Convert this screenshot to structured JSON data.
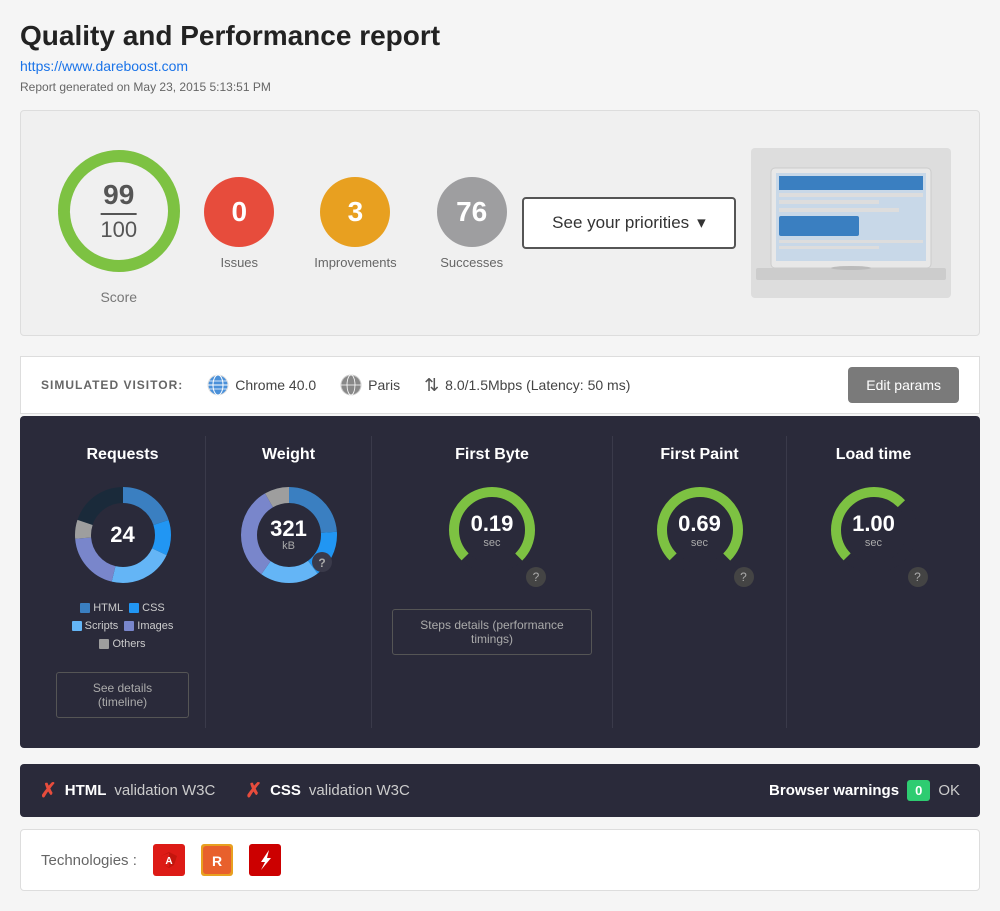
{
  "header": {
    "title": "Quality and Performance report",
    "url": "https://www.dareboost.com",
    "date": "Report generated on May 23, 2015 5:13:51 PM"
  },
  "score_panel": {
    "score_num": "99",
    "score_denom": "100",
    "score_label": "Score",
    "issues": {
      "value": "0",
      "label": "Issues"
    },
    "improvements": {
      "value": "3",
      "label": "Improvements"
    },
    "successes": {
      "value": "76",
      "label": "Successes"
    },
    "priorities_btn": "See your priorities"
  },
  "visitor_bar": {
    "label": "SIMULATED VISITOR:",
    "browser": "Chrome 40.0",
    "location": "Paris",
    "speed": "8.0/1.5Mbps (Latency: 50 ms)",
    "edit_btn": "Edit params"
  },
  "metrics": {
    "requests": {
      "title": "Requests",
      "value": "24",
      "legend": [
        {
          "color": "#3a7fc1",
          "label": "HTML"
        },
        {
          "color": "#2196F3",
          "label": "CSS"
        },
        {
          "color": "#64b5f6",
          "label": "Scripts"
        },
        {
          "color": "#7986cb",
          "label": "Images"
        },
        {
          "color": "#9e9e9e",
          "label": "Others"
        }
      ]
    },
    "weight": {
      "title": "Weight",
      "value": "321",
      "unit": "kB"
    },
    "first_byte": {
      "title": "First Byte",
      "value": "0.19",
      "unit": "sec"
    },
    "first_paint": {
      "title": "First Paint",
      "value": "0.69",
      "unit": "sec"
    },
    "load_time": {
      "title": "Load time",
      "value": "1.00",
      "unit": "sec"
    },
    "details_btn": "See details (timeline)",
    "steps_btn": "Steps details (performance timings)"
  },
  "validation": {
    "html_label": "HTML",
    "html_text": "validation W3C",
    "css_label": "CSS",
    "css_text": "validation W3C",
    "browser_warnings_label": "Browser warnings",
    "browser_warnings_value": "0",
    "ok_text": "OK"
  },
  "technologies": {
    "label": "Technologies :"
  }
}
